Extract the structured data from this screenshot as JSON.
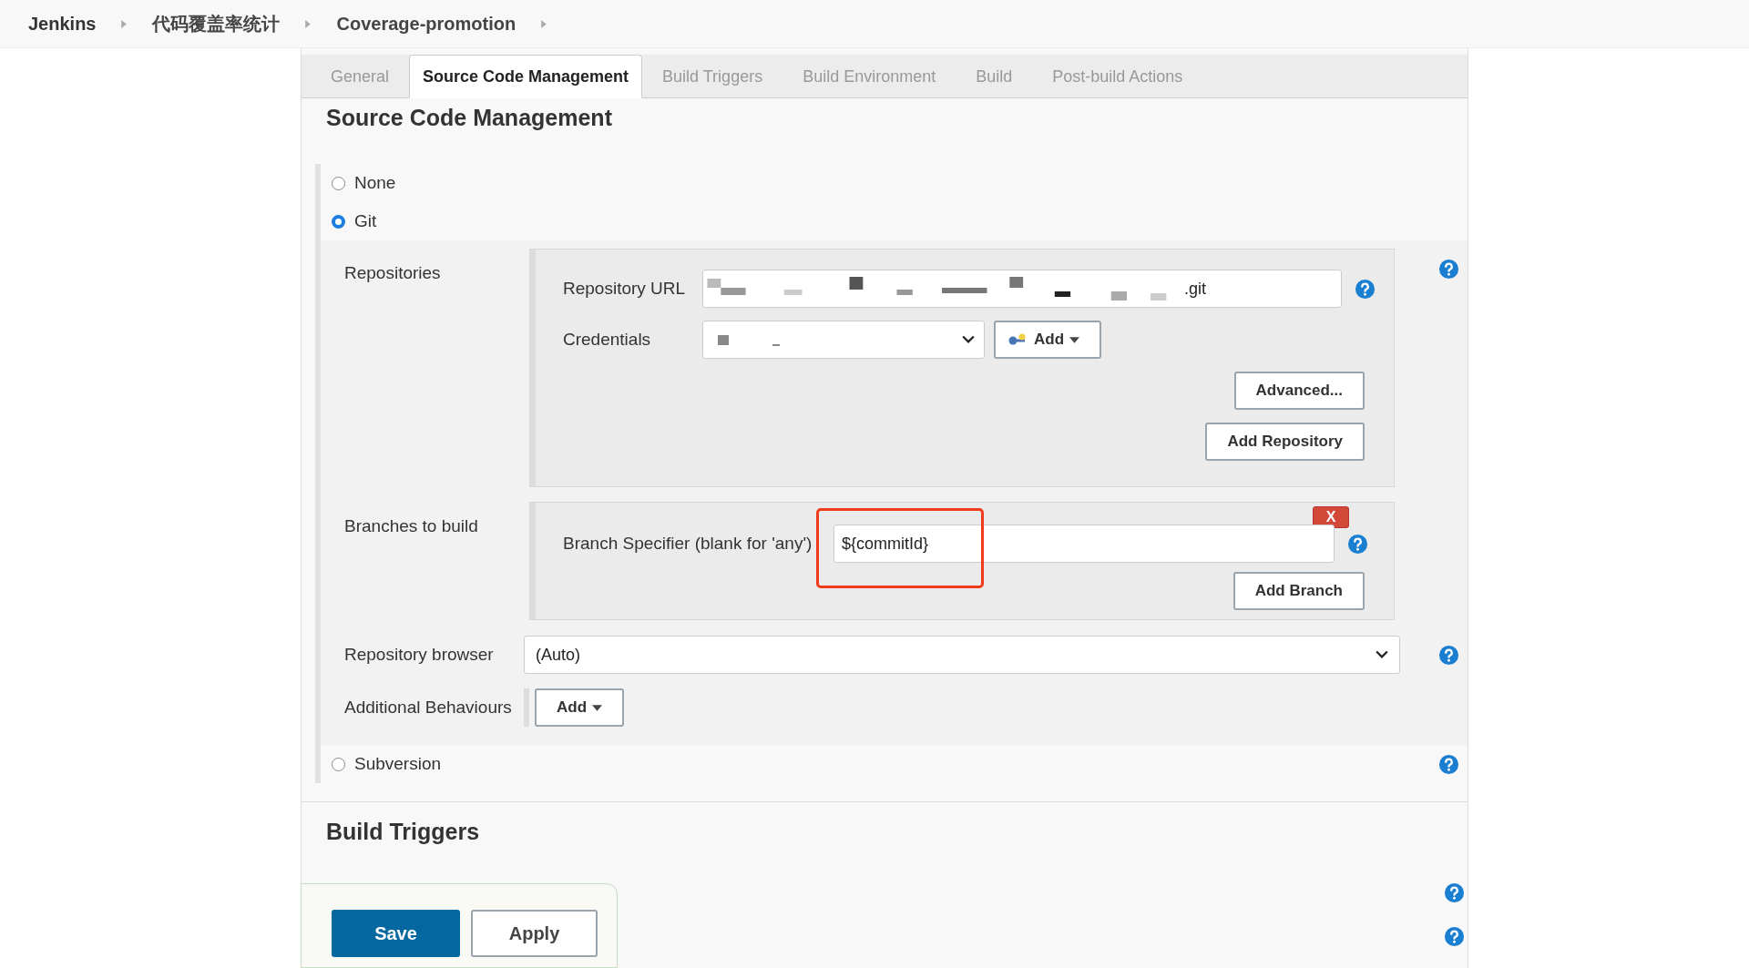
{
  "breadcrumbs": [
    {
      "label": "Jenkins"
    },
    {
      "label": "代码覆盖率统计"
    },
    {
      "label": "Coverage-promotion"
    }
  ],
  "tabs": [
    {
      "label": "General",
      "selected": false
    },
    {
      "label": "Source Code Management",
      "selected": true
    },
    {
      "label": "Build Triggers",
      "selected": false
    },
    {
      "label": "Build Environment",
      "selected": false
    },
    {
      "label": "Build",
      "selected": false
    },
    {
      "label": "Post-build Actions",
      "selected": false
    }
  ],
  "scm": {
    "title": "Source Code Management",
    "options": [
      {
        "label": "None",
        "kind": "none",
        "selected": false
      },
      {
        "label": "Git",
        "kind": "git",
        "selected": true
      },
      {
        "label": "Subversion",
        "kind": "svn",
        "selected": false
      }
    ]
  },
  "git": {
    "repositories_label": "Repositories",
    "repository_url_label": "Repository URL",
    "repository_url_value": ".git",
    "credentials_label": "Credentials",
    "credentials_add": "Add",
    "advanced_button": "Advanced...",
    "add_repository_button": "Add Repository",
    "branches_label": "Branches to build",
    "branch_specifier_label": "Branch Specifier (blank for 'any')",
    "branch_specifier_value": "${commitId}",
    "delete_button": "X",
    "add_branch_button": "Add Branch",
    "repository_browser_label": "Repository browser",
    "repository_browser_value": "(Auto)",
    "additional_behaviours_label": "Additional Behaviours",
    "additional_behaviours_add": "Add"
  },
  "build_triggers": {
    "title": "Build Triggers"
  },
  "buttons": [
    {
      "label": "Save",
      "kind": "primary"
    },
    {
      "label": "Apply",
      "kind": "secondary"
    }
  ]
}
